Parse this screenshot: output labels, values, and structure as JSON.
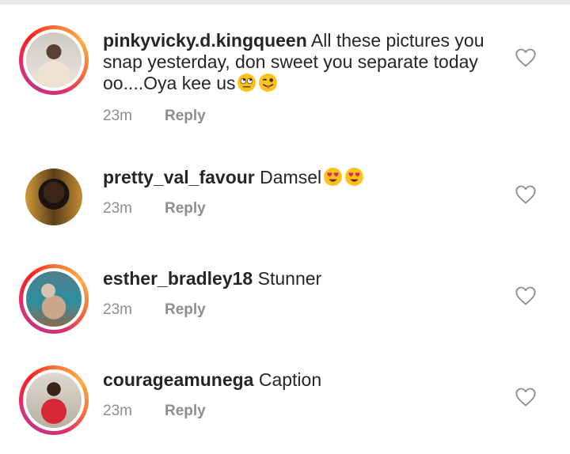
{
  "comments": [
    {
      "username": "pinkyvicky.d.kingqueen",
      "text": "All these pictures you snap yesterday, don sweet you separate today oo....Oya kee us",
      "emojis": [
        "face-with-rolling-eyes",
        "winking-face-with-tongue"
      ],
      "time": "23m",
      "reply": "Reply"
    },
    {
      "username": "pretty_val_favour",
      "text": "Damsel",
      "emojis": [
        "smiling-face-with-heart-eyes",
        "smiling-face-with-heart-eyes"
      ],
      "time": "23m",
      "reply": "Reply"
    },
    {
      "username": "esther_bradley18",
      "text": "Stunner",
      "emojis": [],
      "time": "23m",
      "reply": "Reply"
    },
    {
      "username": "courageamunega",
      "text": "Caption",
      "emojis": [],
      "time": "23m",
      "reply": "Reply"
    }
  ],
  "icons": {
    "like": "heart-outline-icon"
  },
  "colors": {
    "text": "#262626",
    "meta": "#8e8e8e",
    "ring_start": "#c13584",
    "ring_end": "#fcaf45"
  }
}
